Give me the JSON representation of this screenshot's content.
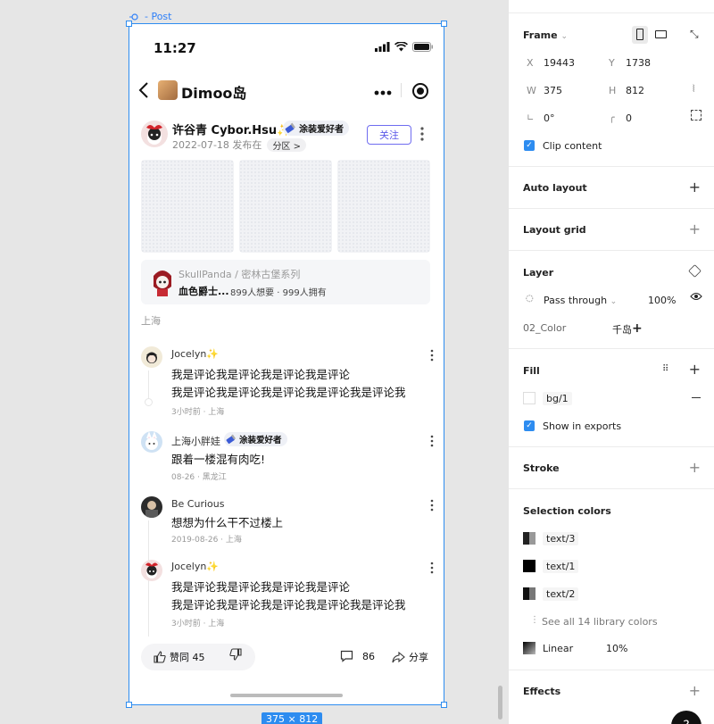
{
  "frame_label": "- Post",
  "size_badge": "375 × 812",
  "post": {
    "status_time": "11:27",
    "nav_title": "Dimoo岛",
    "author_name": "许谷青 Cybor.Hsu✨",
    "author_badge": "涂装爱好者",
    "post_date": "2022-07-18 发布在",
    "zone": "分区 >",
    "follow_label": "关注",
    "product_series": "SkullPanda / 密林古堡系列",
    "product_name": "血色爵士...",
    "product_stats": "899人想要 · 999人拥有",
    "location": "上海",
    "comments": [
      {
        "name": "Jocelyn✨",
        "badge": "",
        "lines": [
          "我是评论我是评论我是评论我是评论",
          "我是评论我是评论我是评论我是评论我是评论我"
        ],
        "meta": "3小时前 · 上海"
      },
      {
        "name": "上海小胖娃",
        "badge": "涂装爱好者",
        "lines": [
          "跟着一楼混有肉吃!"
        ],
        "meta": "08-26 · 黑龙江"
      },
      {
        "name": "Be Curious",
        "badge": "",
        "lines": [
          "想想为什么干不过楼上"
        ],
        "meta": "2019-08-26 · 上海"
      },
      {
        "name": "Jocelyn✨",
        "badge": "",
        "lines": [
          "我是评论我是评论我是评论我是评论",
          "我是评论我是评论我是评论我是评论我是评论我"
        ],
        "meta": "3小时前 · 上海"
      }
    ],
    "like_label": "赞同 45",
    "comment_count": "86",
    "share_label": "分享"
  },
  "panel": {
    "frame_title": "Frame",
    "x_label": "X",
    "x_value": "19443",
    "y_label": "Y",
    "y_value": "1738",
    "w_label": "W",
    "w_value": "375",
    "h_label": "H",
    "h_value": "812",
    "rotation_value": "0°",
    "radius_value": "0",
    "clip_label": "Clip content",
    "auto_layout": "Auto layout",
    "layout_grid": "Layout grid",
    "layer_title": "Layer",
    "blend_mode": "Pass through",
    "opacity": "100%",
    "color_token": "02_Color",
    "color_token_value": "千岛",
    "fill_title": "Fill",
    "fill_value": "bg/1",
    "show_exports": "Show in exports",
    "stroke_title": "Stroke",
    "selection_colors_title": "Selection colors",
    "selection_colors": [
      "text/3",
      "text/1",
      "text/2"
    ],
    "see_all": "See all 14 library colors",
    "linear_label": "Linear",
    "linear_value": "10%",
    "effects_title": "Effects",
    "help": "?"
  }
}
